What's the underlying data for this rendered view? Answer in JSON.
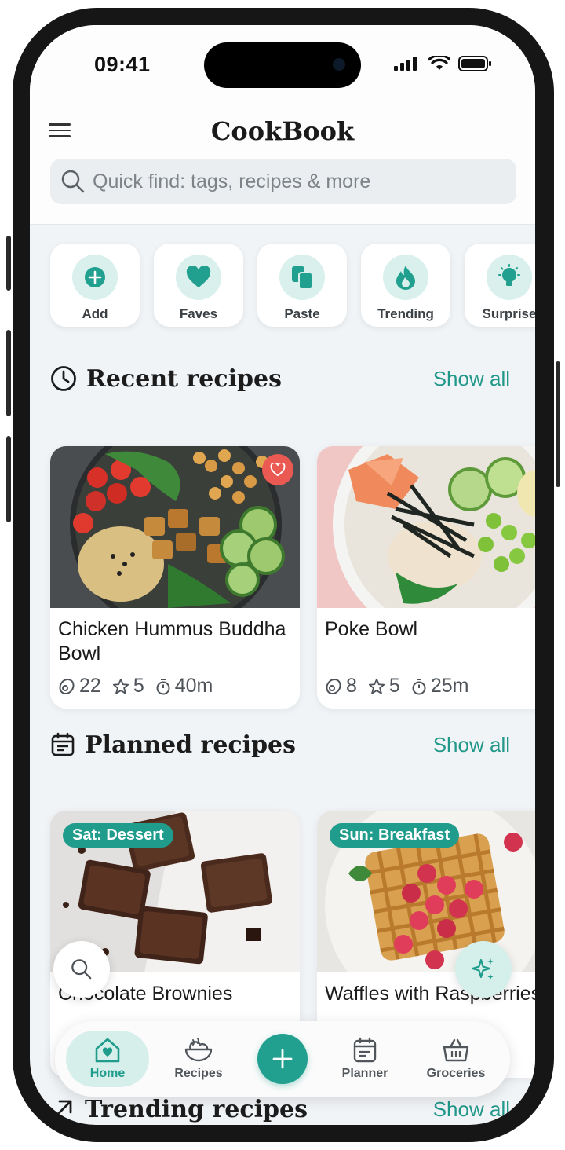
{
  "status": {
    "time": "09:41"
  },
  "app": {
    "title": "CookBook",
    "search_placeholder": "Quick find: tags, recipes & more"
  },
  "quick_actions": [
    {
      "label": "Add",
      "icon": "plus-icon"
    },
    {
      "label": "Faves",
      "icon": "heart-icon"
    },
    {
      "label": "Paste",
      "icon": "paste-icon"
    },
    {
      "label": "Trending",
      "icon": "flame-icon"
    },
    {
      "label": "Surprise",
      "icon": "lightbulb-icon"
    }
  ],
  "recent": {
    "title": "Recent recipes",
    "show_all": "Show all",
    "cards": [
      {
        "name": "Chicken Hummus Buddha Bowl",
        "ingredients": "22",
        "rating": "5",
        "time": "40m"
      },
      {
        "name": "Poke Bowl",
        "ingredients": "8",
        "rating": "5",
        "time": "25m"
      }
    ]
  },
  "planned": {
    "title": "Planned recipes",
    "show_all": "Show all",
    "cards": [
      {
        "tag": "Sat: Dessert",
        "name": "Chocolate Brownies"
      },
      {
        "tag": "Sun: Breakfast",
        "name": "Waffles with Raspberries"
      }
    ]
  },
  "trending": {
    "title": "Trending recipes",
    "show_all": "Show all"
  },
  "tabs": [
    {
      "label": "Home",
      "icon": "home-icon",
      "active": true
    },
    {
      "label": "Recipes",
      "icon": "bowl-icon"
    },
    {
      "label": "Planner",
      "icon": "calendar-icon"
    },
    {
      "label": "Groceries",
      "icon": "basket-icon"
    }
  ],
  "colors": {
    "accent": "#22a08f",
    "fav": "#ea5a52",
    "background": "#f1f4f7"
  }
}
